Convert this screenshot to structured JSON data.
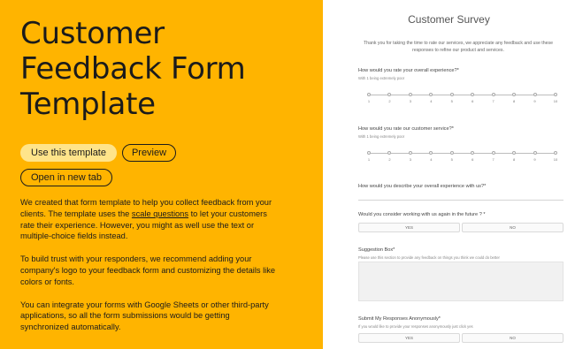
{
  "hero": {
    "title": "Customer Feedback Form Template",
    "btn_use": "Use this template",
    "btn_preview": "Preview",
    "btn_newtab": "Open in new tab",
    "p1_before": "We created that form template to help you collect feedback from your clients. The template uses the ",
    "p1_link": "scale questions",
    "p1_after": " to let your customers rate their experience. However, you might as well use the text or multiple-choice fields instead.",
    "p2": "To build trust with your responders, we recommend adding your company's logo to your feedback form and customizing the details like colors or fonts.",
    "p3": "You can integrate your forms with Google Sheets or other third-party applications, so all the form submissions would be getting synchronized automatically."
  },
  "survey": {
    "title": "Customer Survey",
    "intro": "Thank you for taking the time to rate our services, we appreciate any feedback and use these responses to refine our product and services.",
    "q1": "How would you rate your overall experience?*",
    "q1_hint": "With 1 being extremely poor",
    "q2": "How would you rate our customer service?*",
    "q2_hint": "With 1 being extremely poor",
    "scale_labels": [
      "1",
      "2",
      "3",
      "4",
      "5",
      "6",
      "7",
      "8",
      "9",
      "10"
    ],
    "q3": "How would you describe your overall experience with us?*",
    "q4": "Would you consider working with us again in the future ? *",
    "yes": "YES",
    "no": "NO",
    "q5": "Suggestion Box*",
    "q5_hint": "Please use this section to provide any feedback on things you think we could do better",
    "q6": "Submit My Responses Anonymously*",
    "q6_hint": "If you would like to provide your responses anonymously just click yes"
  },
  "colors": {
    "accent": "#FFB400",
    "button_primary": "#FFE48A"
  }
}
